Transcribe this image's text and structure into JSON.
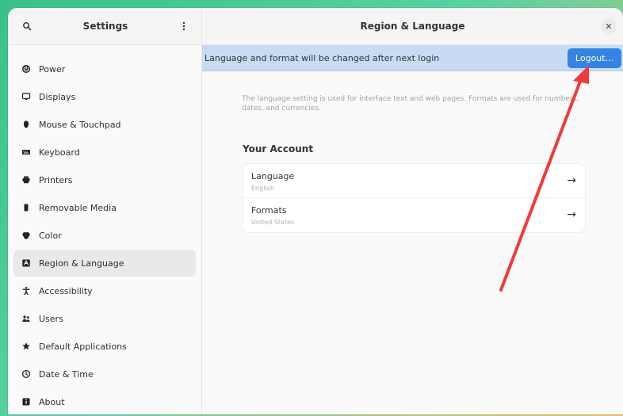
{
  "sidebar": {
    "title": "Settings",
    "items": [
      {
        "label": "Power",
        "icon": "power-icon"
      },
      {
        "label": "Displays",
        "icon": "display-icon"
      },
      {
        "label": "Mouse & Touchpad",
        "icon": "mouse-icon"
      },
      {
        "label": "Keyboard",
        "icon": "keyboard-icon"
      },
      {
        "label": "Printers",
        "icon": "printer-icon"
      },
      {
        "label": "Removable Media",
        "icon": "media-icon"
      },
      {
        "label": "Color",
        "icon": "color-icon"
      },
      {
        "label": "Region & Language",
        "icon": "region-icon"
      },
      {
        "label": "Accessibility",
        "icon": "accessibility-icon"
      },
      {
        "label": "Users",
        "icon": "users-icon"
      },
      {
        "label": "Default Applications",
        "icon": "star-icon"
      },
      {
        "label": "Date & Time",
        "icon": "clock-icon"
      },
      {
        "label": "About",
        "icon": "info-icon"
      }
    ]
  },
  "main": {
    "title": "Region & Language",
    "banner": {
      "text": "Language and format will be changed after next login",
      "button_label": "Logout..."
    },
    "description": "The language setting is used for interface text and web pages. Formats are used for numbers, dates, and currencies.",
    "section_title": "Your Account",
    "rows": [
      {
        "title": "Language",
        "value": "English"
      },
      {
        "title": "Formats",
        "value": "United States"
      }
    ]
  },
  "colors": {
    "accent": "#3584e4",
    "banner": "#c7dcf4",
    "annotation": "#ef3b3b"
  }
}
